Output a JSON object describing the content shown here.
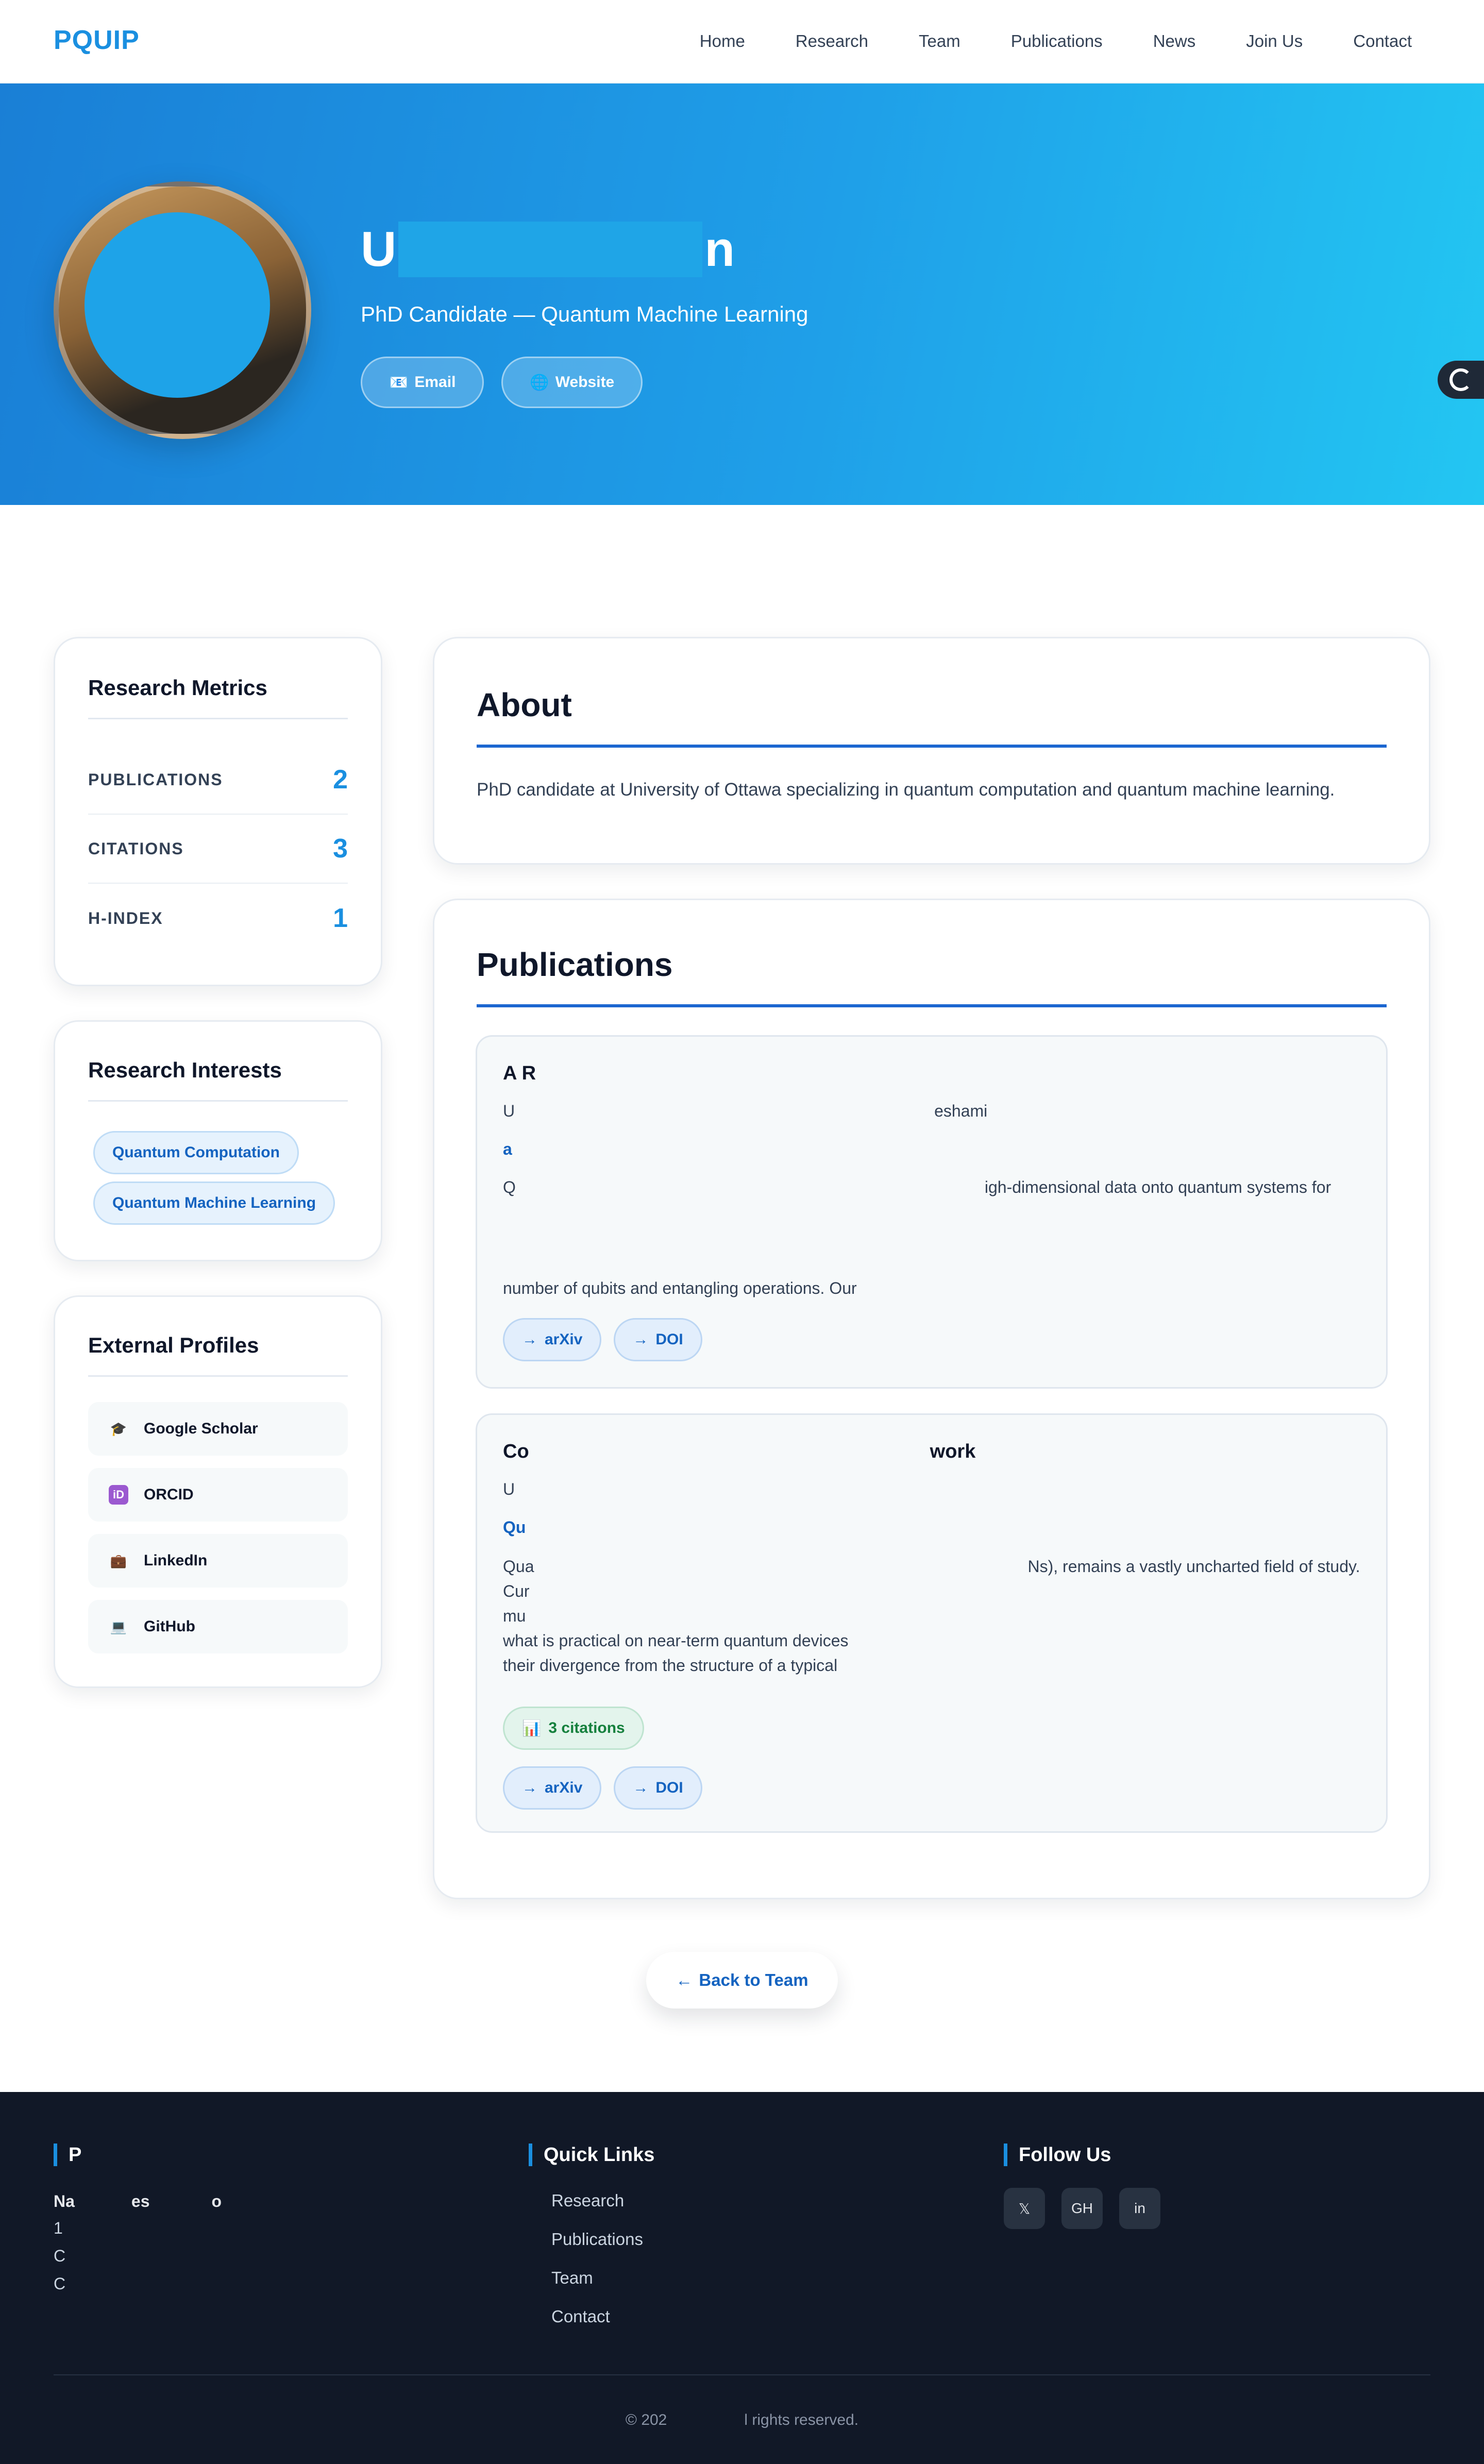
{
  "nav": {
    "logo": "PQUIP",
    "links": [
      "Home",
      "Research",
      "Team",
      "Publications",
      "News",
      "Join Us",
      "Contact"
    ]
  },
  "hero": {
    "name_start": "U",
    "name_end": "n",
    "role": "PhD Candidate — Quantum Machine Learning",
    "email_label": "Email",
    "website_label": "Website"
  },
  "metrics": {
    "title": "Research Metrics",
    "rows": [
      {
        "label": "PUBLICATIONS",
        "value": "2"
      },
      {
        "label": "CITATIONS",
        "value": "3"
      },
      {
        "label": "H-INDEX",
        "value": "1"
      }
    ]
  },
  "interests": {
    "title": "Research Interests",
    "items": [
      "Quantum Computation",
      "Quantum Machine Learning"
    ]
  },
  "profiles": {
    "title": "External Profiles",
    "items": [
      "Google Scholar",
      "ORCID",
      "LinkedIn",
      "GitHub"
    ]
  },
  "about": {
    "title": "About",
    "text": "PhD candidate at University of Ottawa specializing in quantum computation and quantum machine learning."
  },
  "publications": {
    "title": "Publications",
    "items": [
      {
        "title": "A R",
        "authors_start": "U",
        "authors_end": "eshami",
        "venue": "a",
        "abstract_start": "Q",
        "abstract_tail": "igh-dimensional data onto quantum systems for",
        "abstract_line2": "number of qubits and entangling operations. Our",
        "links": [
          "arXiv",
          "DOI"
        ]
      },
      {
        "title_start": "Co",
        "title_end": "work",
        "authors_start": "U",
        "venue": "Qu",
        "abstract_lines": [
          "Qua",
          "Cur",
          "mu",
          "what is practical on near-term quantum devices",
          "their divergence from the structure of a typical"
        ],
        "abstract_tail": "Ns), remains a vastly uncharted field of study.",
        "citations": "3 citations",
        "links": [
          "arXiv",
          "DOI"
        ]
      }
    ]
  },
  "back_label": "Back to Team",
  "footer": {
    "col1_title": "P",
    "col1_line1_start": "Na",
    "col1_line1_mid": "es",
    "col1_line1_end": "o",
    "col1_lines": [
      "1",
      "C",
      "C"
    ],
    "quick_title": "Quick Links",
    "quick_links": [
      "Research",
      "Publications",
      "Team",
      "Contact"
    ],
    "follow_title": "Follow Us",
    "social": [
      "𝕏",
      "GH",
      "in"
    ],
    "copyright_start": "© 202",
    "copyright_end": "l rights reserved."
  }
}
